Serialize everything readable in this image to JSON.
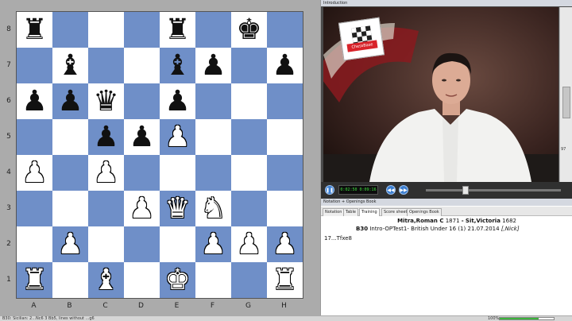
{
  "board": {
    "files": [
      "A",
      "B",
      "C",
      "D",
      "E",
      "F",
      "G",
      "H"
    ],
    "ranks": [
      "8",
      "7",
      "6",
      "5",
      "4",
      "3",
      "2",
      "1"
    ],
    "position": [
      [
        "r",
        "",
        "",
        "",
        "r",
        "",
        "k",
        ""
      ],
      [
        "",
        "b",
        "",
        "",
        "b",
        "p",
        "",
        "p"
      ],
      [
        "p",
        "p",
        "q",
        "",
        "p",
        "",
        "",
        ""
      ],
      [
        "",
        "",
        "p",
        "p",
        "P",
        "",
        "",
        ""
      ],
      [
        "P",
        "",
        "P",
        "",
        "",
        "",
        "",
        ""
      ],
      [
        "",
        "",
        "",
        "P",
        "Q",
        "N",
        "",
        ""
      ],
      [
        "",
        "P",
        "",
        "",
        "",
        "P",
        "P",
        "P"
      ],
      [
        "R",
        "",
        "B",
        "",
        "K",
        "",
        "",
        "R"
      ]
    ],
    "colors": {
      "light": "#ffffff",
      "dark": "#6f8fc8"
    }
  },
  "video": {
    "title": "Introduction",
    "time": "0:02:50  0:09:16",
    "scroll_value": "97",
    "logo_text": "ChessBase"
  },
  "notation": {
    "title": "Notation + Openings Book",
    "tabs": [
      "Notation",
      "Table",
      "Training",
      "Score sheet",
      "Openings Book"
    ],
    "active_tab": "Training",
    "white_player": "Mitra,Roman C",
    "white_elo": "1871",
    "separator": "-",
    "black_player": "Sit,Victoria",
    "black_elo": "1682",
    "eco": "B30",
    "event": "Intro-OPTest1- British Under 16",
    "round": "(1)",
    "date": "21.07.2014",
    "annotator": "[,Nick]",
    "move": "17...Tfxe8"
  },
  "status": {
    "text": "B30: Sicilian: 2...Nc6 3 Bb5, lines without ...g6",
    "zoom": "100%",
    "zoom_fraction": 0.72
  }
}
